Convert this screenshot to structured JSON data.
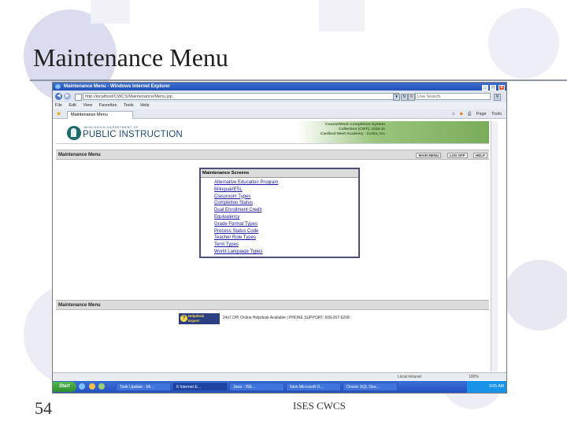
{
  "slide": {
    "title": "Maintenance Menu",
    "number": "54",
    "footer": "ISES CWCS"
  },
  "browser": {
    "window_title": "Maintenance Menu - Windows Internet Explorer",
    "window_buttons": [
      "_",
      "□",
      "X"
    ],
    "address": "http://localhost/CWCS/Maintenance/Menu.jsp",
    "search_placeholder": "Live Search",
    "menu": [
      "File",
      "Edit",
      "View",
      "Favorites",
      "Tools",
      "Help"
    ],
    "tab_label": "Maintenance Menu",
    "toolbar": [
      "Page",
      "Tools"
    ],
    "status_zone": "Local intranet",
    "zoom": "100%"
  },
  "page": {
    "logo_small": "WISCONSIN DEPARTMENT OF",
    "logo_name": "PUBLIC INSTRUCTION",
    "app_info": [
      "Course/Work Completion System",
      "Collection (CWT): 2010-11",
      "Cardinal West Academy - Sorbo, Inc"
    ],
    "section_title": "Maintenance Menu",
    "quick_links": [
      "MAIN MENU",
      "LOG OFF",
      "HELP"
    ],
    "screens_box_title": "Maintenance Screens",
    "screens": [
      "Alternative Education Program",
      "Bilingual/ESL",
      "Classroom Types",
      "Completion Status",
      "Dual Enrollment Credit",
      "Equivalency",
      "Grade Format Types",
      "Process Status Code",
      "Teacher Role Types",
      "Term Types",
      "World Language Types"
    ],
    "footer_section_title": "Maintenance Menu",
    "helpdesk_badge": [
      "Helpdesk",
      "Expert"
    ],
    "helpdesk_text": "24x7 DPI Online Helpdesk Available | PHONE SUPPORT: 608-267-9268"
  },
  "taskbar": {
    "start": "Start",
    "tasks": [
      "Task Update - Mi...",
      "6 Internet E...",
      "Java - ISE...",
      "New Microsoft O...",
      "Oracle SQL Dev..."
    ],
    "clock": "3:55 AM"
  },
  "colors": {
    "ie_titlebar": "#2450b8",
    "taskbar": "#2450c0",
    "dpi_blue": "#1d4c7a",
    "dpi_green": "#7aac5a",
    "link": "#1a1aa6"
  }
}
